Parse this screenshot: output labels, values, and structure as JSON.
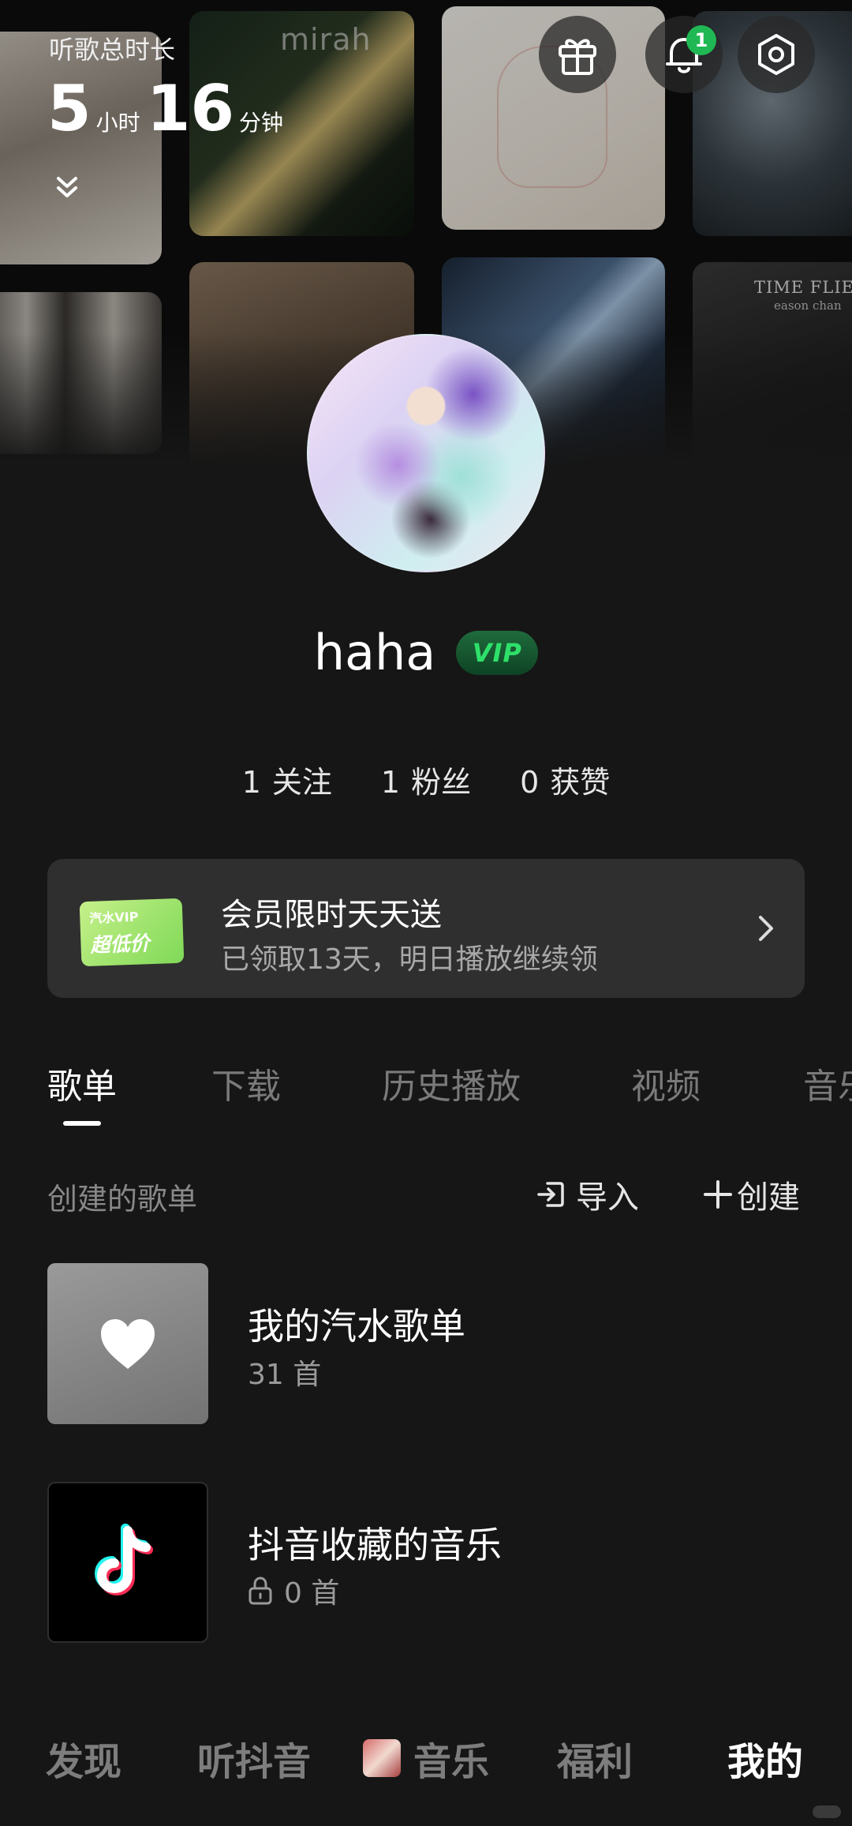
{
  "header": {
    "listen_label": "听歌总时长",
    "hours": "5",
    "hours_unit": "小时",
    "minutes": "16",
    "minutes_unit": "分钟",
    "notification_count": "1",
    "collage_texts": {
      "album2": "mirah",
      "album8_title": "TIME FLIES",
      "album8_artist": "eason chan"
    }
  },
  "profile": {
    "username": "haha",
    "vip_label": "VIP",
    "stats": [
      {
        "num": "1",
        "label": "关注"
      },
      {
        "num": "1",
        "label": "粉丝"
      },
      {
        "num": "0",
        "label": "获赞"
      }
    ]
  },
  "promo": {
    "ticket_top": "汽水VIP",
    "ticket_main": "超低价",
    "title": "会员限时天天送",
    "subtitle": "已领取13天，明日播放继续领"
  },
  "tabs": [
    "歌单",
    "下载",
    "历史播放",
    "视频",
    "音乐"
  ],
  "playlists": {
    "section_title": "创建的歌单",
    "import_label": "导入",
    "create_label": "创建",
    "items": [
      {
        "title": "我的汽水歌单",
        "count": "31 首"
      },
      {
        "title": "抖音收藏的音乐",
        "count": "0 首"
      }
    ]
  },
  "bottom_nav": [
    "发现",
    "听抖音",
    "音乐",
    "福利",
    "我的"
  ],
  "colors": {
    "background": "#161616",
    "accent_green": "#1fb854",
    "vip_green": "#2ee06a",
    "card": "#2f2f2f"
  }
}
